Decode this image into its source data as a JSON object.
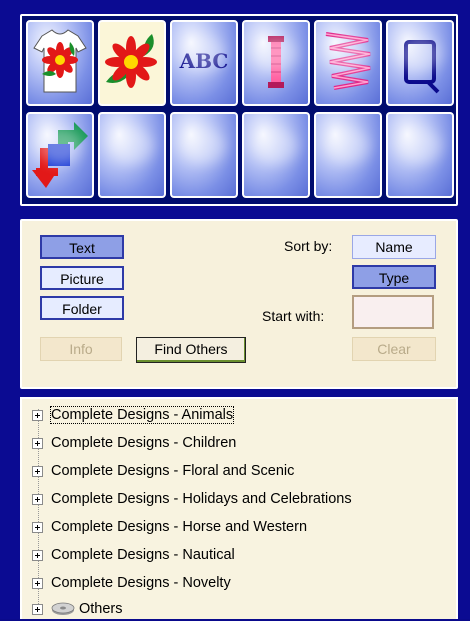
{
  "toolbar": {
    "tiles_row1": [
      "tshirt-design",
      "flower-design",
      "text-abc",
      "thread-spool",
      "stitch-zigzag",
      "hoop-frame"
    ],
    "tiles_row2": [
      "convert-arrows",
      "empty",
      "empty",
      "empty",
      "empty",
      "empty"
    ],
    "abc_label": "ABC"
  },
  "options": {
    "text_label": "Text",
    "picture_label": "Picture",
    "folder_label": "Folder",
    "sort_by_label": "Sort by:",
    "name_label": "Name",
    "type_label": "Type",
    "start_with_label": "Start with:",
    "start_with_value": "",
    "info_label": "Info",
    "find_others_label": "Find Others",
    "clear_label": "Clear"
  },
  "tree": {
    "items": [
      "Complete Designs - Animals",
      "Complete Designs - Children",
      "Complete Designs - Floral and Scenic",
      "Complete Designs - Holidays and Celebrations",
      "Complete Designs - Horse and Western",
      "Complete Designs - Nautical",
      "Complete Designs - Novelty",
      "Others"
    ]
  }
}
